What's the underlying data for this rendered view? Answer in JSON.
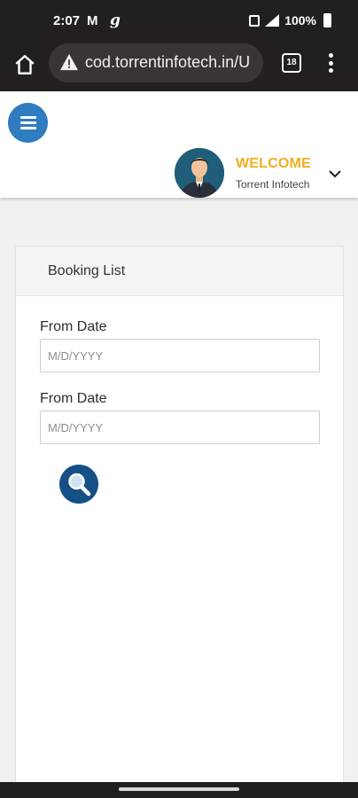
{
  "status_bar": {
    "time": "2:07",
    "mail_glyph": "M",
    "g_glyph": "g",
    "battery": "100%",
    "icons": [
      "gmail-icon",
      "g-icon",
      "calendar-icon",
      "signal-icon",
      "battery-icon"
    ]
  },
  "browser": {
    "url": "cod.torrentinfotech.in/U",
    "tab_count": "18",
    "icons": [
      "home-icon",
      "warning-icon",
      "tabs-icon",
      "more-vert-icon"
    ]
  },
  "header": {
    "welcome": "WELCOME",
    "user_name": "Torrent Infotech",
    "icons": [
      "hamburger-menu-icon",
      "avatar",
      "chevron-down-icon"
    ],
    "accent_color": "#f0ad20",
    "menu_color": "#2f7cc0"
  },
  "booking": {
    "title": "Booking List",
    "from_label": "From Date",
    "from_placeholder": "M/D/YYYY",
    "to_label": "From Date",
    "to_placeholder": "M/D/YYYY",
    "search_color": "#154f86"
  }
}
